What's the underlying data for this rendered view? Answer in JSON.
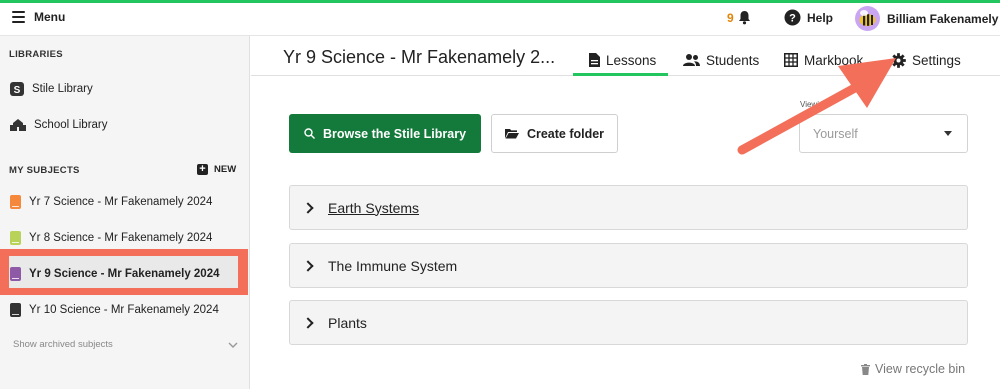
{
  "topbar": {
    "menu_label": "Menu",
    "notification_count": "9",
    "help_label": "Help",
    "user_name": "Billiam Fakenamely"
  },
  "sidebar": {
    "libraries_heading": "LIBRARIES",
    "libraries": [
      {
        "label": "Stile Library",
        "icon": "stile-logo-icon"
      },
      {
        "label": "School Library",
        "icon": "school-icon"
      }
    ],
    "subjects_heading": "MY SUBJECTS",
    "new_label": "NEW",
    "subjects": [
      {
        "label": "Yr 7 Science - Mr Fakenamely 2024",
        "color": "#f5883a"
      },
      {
        "label": "Yr 8 Science - Mr Fakenamely 2024",
        "color": "#b9d35a"
      },
      {
        "label": "Yr 9 Science - Mr Fakenamely 2024",
        "color": "#8e5aa8",
        "selected": true
      },
      {
        "label": "Yr 10 Science - Mr Fakenamely 2024",
        "color": "#333333"
      }
    ],
    "archived_label": "Show archived subjects"
  },
  "header": {
    "subject_title": "Yr 9 Science - Mr Fakenamely 2...",
    "tabs": [
      {
        "label": "Lessons",
        "icon": "document-icon",
        "active": true
      },
      {
        "label": "Students",
        "icon": "people-icon"
      },
      {
        "label": "Markbook",
        "icon": "grid-icon"
      },
      {
        "label": "Settings",
        "icon": "gear-icon"
      }
    ]
  },
  "main": {
    "browse_label": "Browse the Stile Library",
    "create_folder_label": "Create folder",
    "viewing_label": "Viewing",
    "viewing_value": "Yourself",
    "folders": [
      {
        "name": "Earth Systems",
        "underlined": true
      },
      {
        "name": "The Immune System"
      },
      {
        "name": "Plants"
      }
    ],
    "recycle_label": "View recycle bin"
  },
  "colors": {
    "accent_green": "#22c55e",
    "button_green": "#147a3b",
    "highlight_red": "#f36f5a"
  }
}
